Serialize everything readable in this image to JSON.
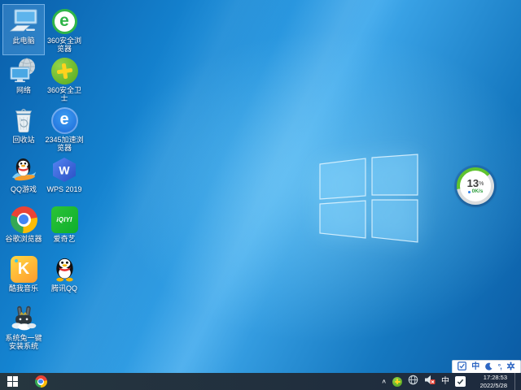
{
  "desktop": {
    "icons_col1": [
      {
        "label": "此电脑"
      },
      {
        "label": "网络"
      },
      {
        "label": "回收站"
      },
      {
        "label": "QQ游戏"
      },
      {
        "label": "谷歌浏览器"
      },
      {
        "label": "酷我音乐"
      },
      {
        "label": "系统兔一键安装系统"
      }
    ],
    "icons_col2": [
      {
        "label": "360安全浏览器"
      },
      {
        "label": "360安全卫士"
      },
      {
        "label": "2345加速浏览器"
      },
      {
        "label": "WPS 2019"
      },
      {
        "label": "爱奇艺"
      },
      {
        "label": "腾讯QQ"
      }
    ],
    "logo_text": {
      "browser360": "e",
      "browser2345": "e",
      "wps": "W",
      "kuwo": "K",
      "iqiyi": "iQIYI"
    },
    "progress": {
      "value": "13",
      "unit": "%",
      "speed": "0K/s"
    }
  },
  "ime_bar": {
    "mode": "中",
    "punct": "°,"
  },
  "taskbar": {
    "tray": {
      "chevron": "∧",
      "input_mode": "中"
    },
    "clock": {
      "time": "17:28:53",
      "date": "2022/5/28"
    }
  },
  "colors": {
    "wallpaper": "#1583cf",
    "taskbar": "#22313e",
    "progress_green": "#5fc32e",
    "ime_blue": "#2d66c3",
    "selection": "#9cc8f0"
  }
}
